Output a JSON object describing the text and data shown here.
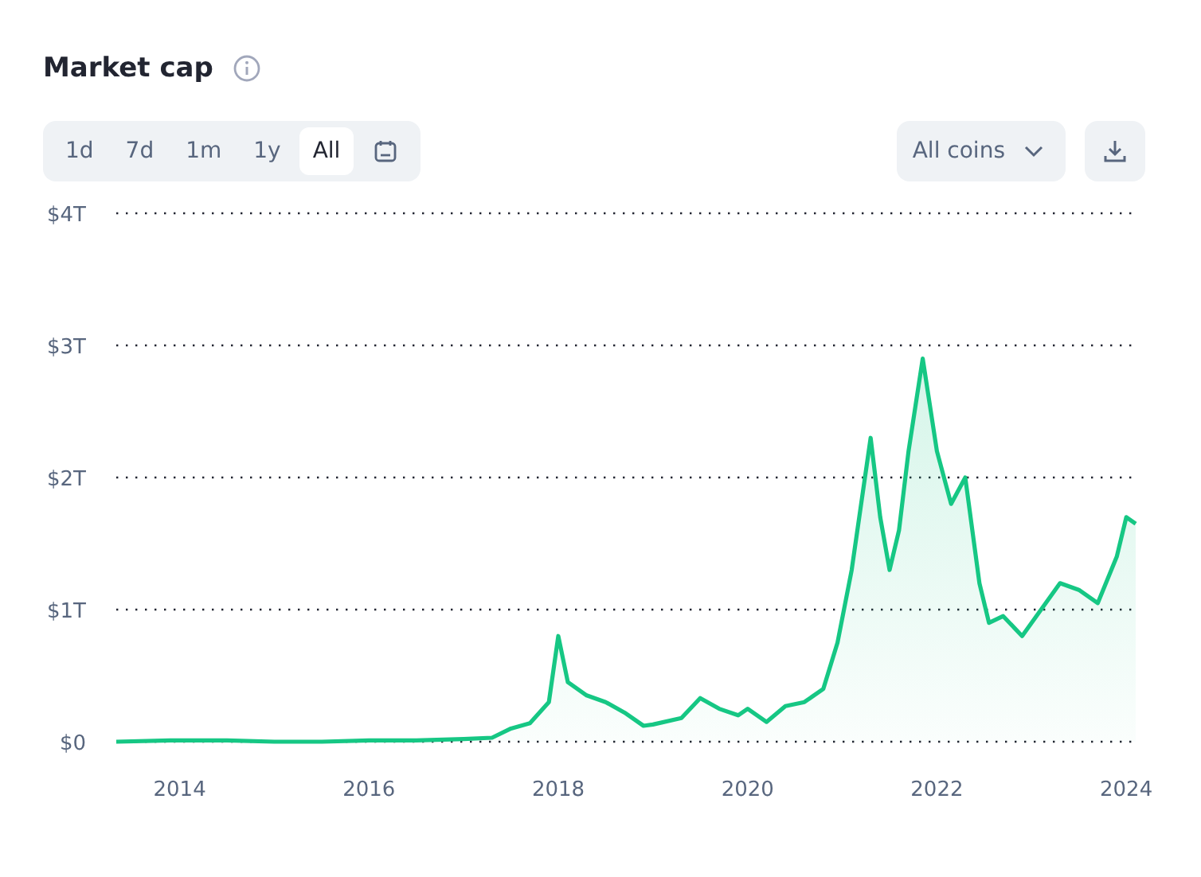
{
  "title": "Market cap",
  "ranges": [
    {
      "label": "1d",
      "selected": false
    },
    {
      "label": "7d",
      "selected": false
    },
    {
      "label": "1m",
      "selected": false
    },
    {
      "label": "1y",
      "selected": false
    },
    {
      "label": "All",
      "selected": true
    }
  ],
  "coin_filter": {
    "label": "All coins"
  },
  "chart_data": {
    "type": "area",
    "x": [
      2013.33,
      2013.9,
      2014.5,
      2015,
      2015.5,
      2016,
      2016.5,
      2017,
      2017.3,
      2017.5,
      2017.7,
      2017.9,
      2018,
      2018.1,
      2018.3,
      2018.5,
      2018.7,
      2018.9,
      2019,
      2019.3,
      2019.5,
      2019.7,
      2019.9,
      2020,
      2020.2,
      2020.4,
      2020.6,
      2020.8,
      2020.95,
      2021.1,
      2021.3,
      2021.4,
      2021.5,
      2021.6,
      2021.7,
      2021.85,
      2022,
      2022.15,
      2022.3,
      2022.45,
      2022.55,
      2022.7,
      2022.9,
      2023.1,
      2023.3,
      2023.5,
      2023.7,
      2023.9,
      2024,
      2024.1
    ],
    "series": [
      {
        "color": "#16c784",
        "values": [
          0,
          0.01,
          0.01,
          0,
          0,
          0.01,
          0.01,
          0.02,
          0.03,
          0.1,
          0.14,
          0.3,
          0.8,
          0.45,
          0.35,
          0.3,
          0.22,
          0.12,
          0.13,
          0.18,
          0.33,
          0.25,
          0.2,
          0.25,
          0.15,
          0.27,
          0.3,
          0.4,
          0.75,
          1.3,
          2.3,
          1.7,
          1.3,
          1.6,
          2.2,
          2.9,
          2.2,
          1.8,
          2.0,
          1.2,
          0.9,
          0.95,
          0.8,
          1.0,
          1.2,
          1.15,
          1.05,
          1.4,
          1.7,
          1.65
        ]
      }
    ],
    "xlim": [
      2013.33,
      2024.1
    ],
    "ylim": [
      0,
      4
    ],
    "grid": true,
    "yticks": [
      {
        "value": 0,
        "label": "$0"
      },
      {
        "value": 1,
        "label": "$1T"
      },
      {
        "value": 2,
        "label": "$2T"
      },
      {
        "value": 3,
        "label": "$3T"
      },
      {
        "value": 4,
        "label": "$4T"
      }
    ],
    "xticks": [
      2014,
      2016,
      2018,
      2020,
      2022,
      2024
    ]
  }
}
